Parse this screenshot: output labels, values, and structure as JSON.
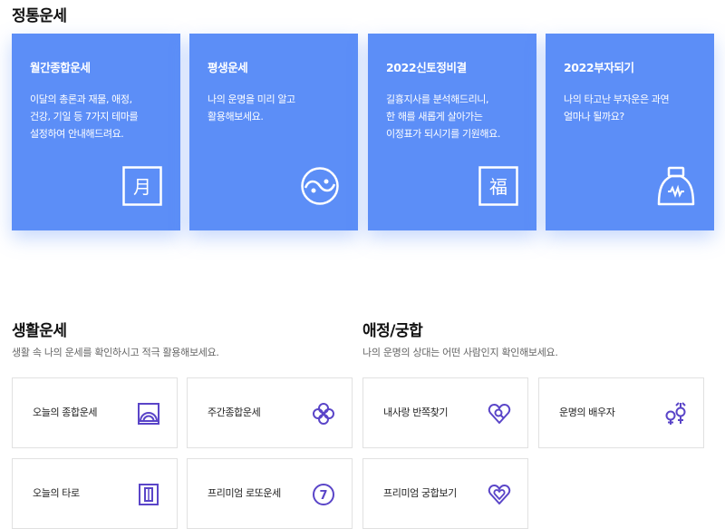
{
  "fortune_section": {
    "title": "정통운세",
    "cards": [
      {
        "title": "월간종합운세",
        "text": "이달의 총론과 재물, 애정,\n건강, 기일 등 7가지 테마를\n설정하여 안내해드려요.",
        "icon": "moon-char-icon",
        "glyph": "月"
      },
      {
        "title": "평생운세",
        "text": "나의 운명을 미리 알고\n활용해보세요.",
        "icon": "yin-yang-icon"
      },
      {
        "title": "2022신토정비결",
        "text": "길흉지사를 분석해드리니,\n한 해를 새롭게 살아가는\n이정표가 되시기를 기원해요.",
        "icon": "luck-char-icon",
        "glyph": "福"
      },
      {
        "title": "2022부자되기",
        "text": "나의 타고난 부자운은 과연\n얼마나 될까요?",
        "icon": "money-bag-icon"
      }
    ]
  },
  "life_section": {
    "title": "생활운세",
    "desc": "생활 속 나의 운세를 확인하시고 적극 활용해보세요.",
    "items": [
      {
        "label": "오늘의 종합운세",
        "icon": "sunrise-icon"
      },
      {
        "label": "주간종합운세",
        "icon": "clover-icon"
      },
      {
        "label": "오늘의 타로",
        "icon": "tarot-cards-icon"
      },
      {
        "label": "프리미엄 로또운세",
        "icon": "lotto-ball-icon",
        "glyph": "7"
      }
    ]
  },
  "love_section": {
    "title": "애정/궁합",
    "desc": "나의 운명의 상대는 어떤 사람인지 확인해보세요.",
    "items": [
      {
        "label": "내사랑 반쪽찾기",
        "icon": "heart-search-icon"
      },
      {
        "label": "운명의 배우자",
        "icon": "gender-symbols-icon"
      },
      {
        "label": "프리미엄 궁합보기",
        "icon": "double-heart-icon"
      }
    ]
  },
  "colors": {
    "card_blue": "#5c8ef7",
    "icon_purple": "#5a45c8"
  }
}
